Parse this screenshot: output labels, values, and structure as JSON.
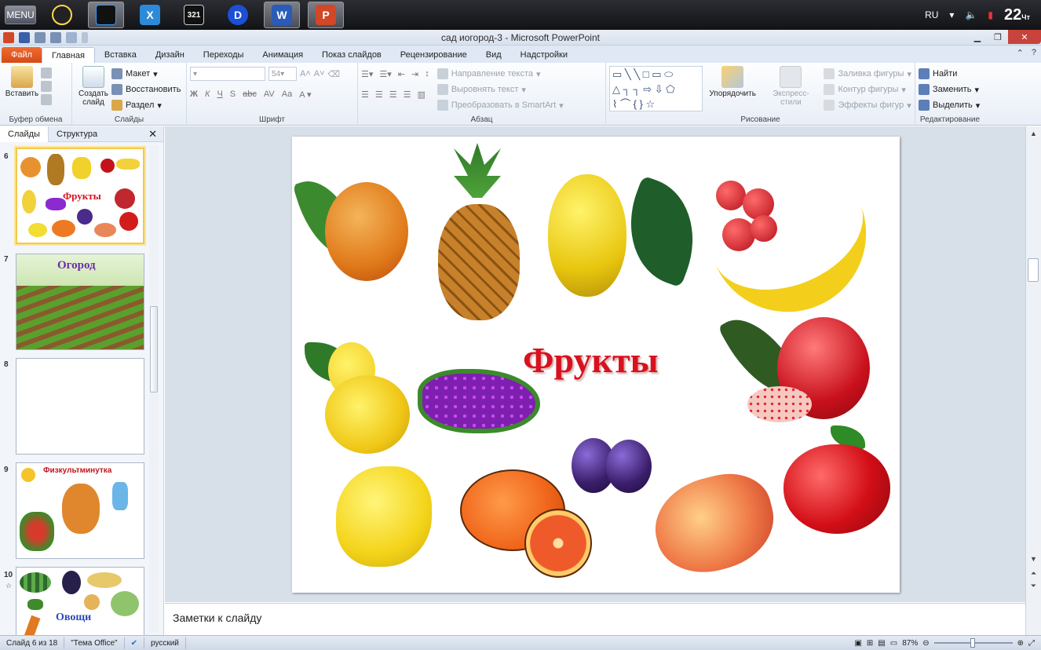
{
  "taskbar": {
    "menu_label": "MENU",
    "lang": "RU",
    "clock": "22",
    "clock_day": "Чт"
  },
  "window": {
    "title": "сад иогород-3  -  Microsoft PowerPoint"
  },
  "tabs": {
    "file": "Файл",
    "home": "Главная",
    "insert": "Вставка",
    "design": "Дизайн",
    "transitions": "Переходы",
    "animation": "Анимация",
    "slideshow": "Показ слайдов",
    "review": "Рецензирование",
    "view": "Вид",
    "addins": "Надстройки"
  },
  "ribbon": {
    "clipboard": {
      "paste": "Вставить",
      "label": "Буфер обмена"
    },
    "slides": {
      "new_slide": "Создать слайд",
      "layout": "Макет",
      "reset": "Восстановить",
      "section": "Раздел",
      "label": "Слайды"
    },
    "font": {
      "size": "54",
      "bold": "Ж",
      "italic": "К",
      "underline": "Ч",
      "strike": "S",
      "shadow": "abc",
      "spacing": "AV",
      "case": "Aa",
      "label": "Шрифт"
    },
    "paragraph": {
      "text_direction": "Направление текста",
      "align_text": "Выровнять текст",
      "smartart": "Преобразовать в SmartArt",
      "label": "Абзац"
    },
    "drawing": {
      "arrange": "Упорядочить",
      "quick_styles": "Экспресс-стили",
      "shape_fill": "Заливка фигуры",
      "shape_outline": "Контур фигуры",
      "shape_effects": "Эффекты фигур",
      "label": "Рисование"
    },
    "editing": {
      "find": "Найти",
      "replace": "Заменить",
      "select": "Выделить",
      "label": "Редактирование"
    }
  },
  "left_pane": {
    "tab_slides": "Слайды",
    "tab_outline": "Структура"
  },
  "thumbnails": [
    {
      "num": "6",
      "title": "Фрукты"
    },
    {
      "num": "7",
      "title": "Огород"
    },
    {
      "num": "8",
      "title": ""
    },
    {
      "num": "9",
      "title": "Физкультминутка"
    },
    {
      "num": "10",
      "title": "Овощи"
    }
  ],
  "slide": {
    "title": "Фрукты"
  },
  "notes": {
    "placeholder": "Заметки к слайду"
  },
  "status": {
    "slide_info": "Слайд 6 из 18",
    "theme": "\"Тема Office\"",
    "language": "русский",
    "zoom": "87%"
  },
  "colors": {
    "file_tab": "#e05a21",
    "title_red": "#d8111e",
    "thumb_selected": "#f2c94c"
  }
}
